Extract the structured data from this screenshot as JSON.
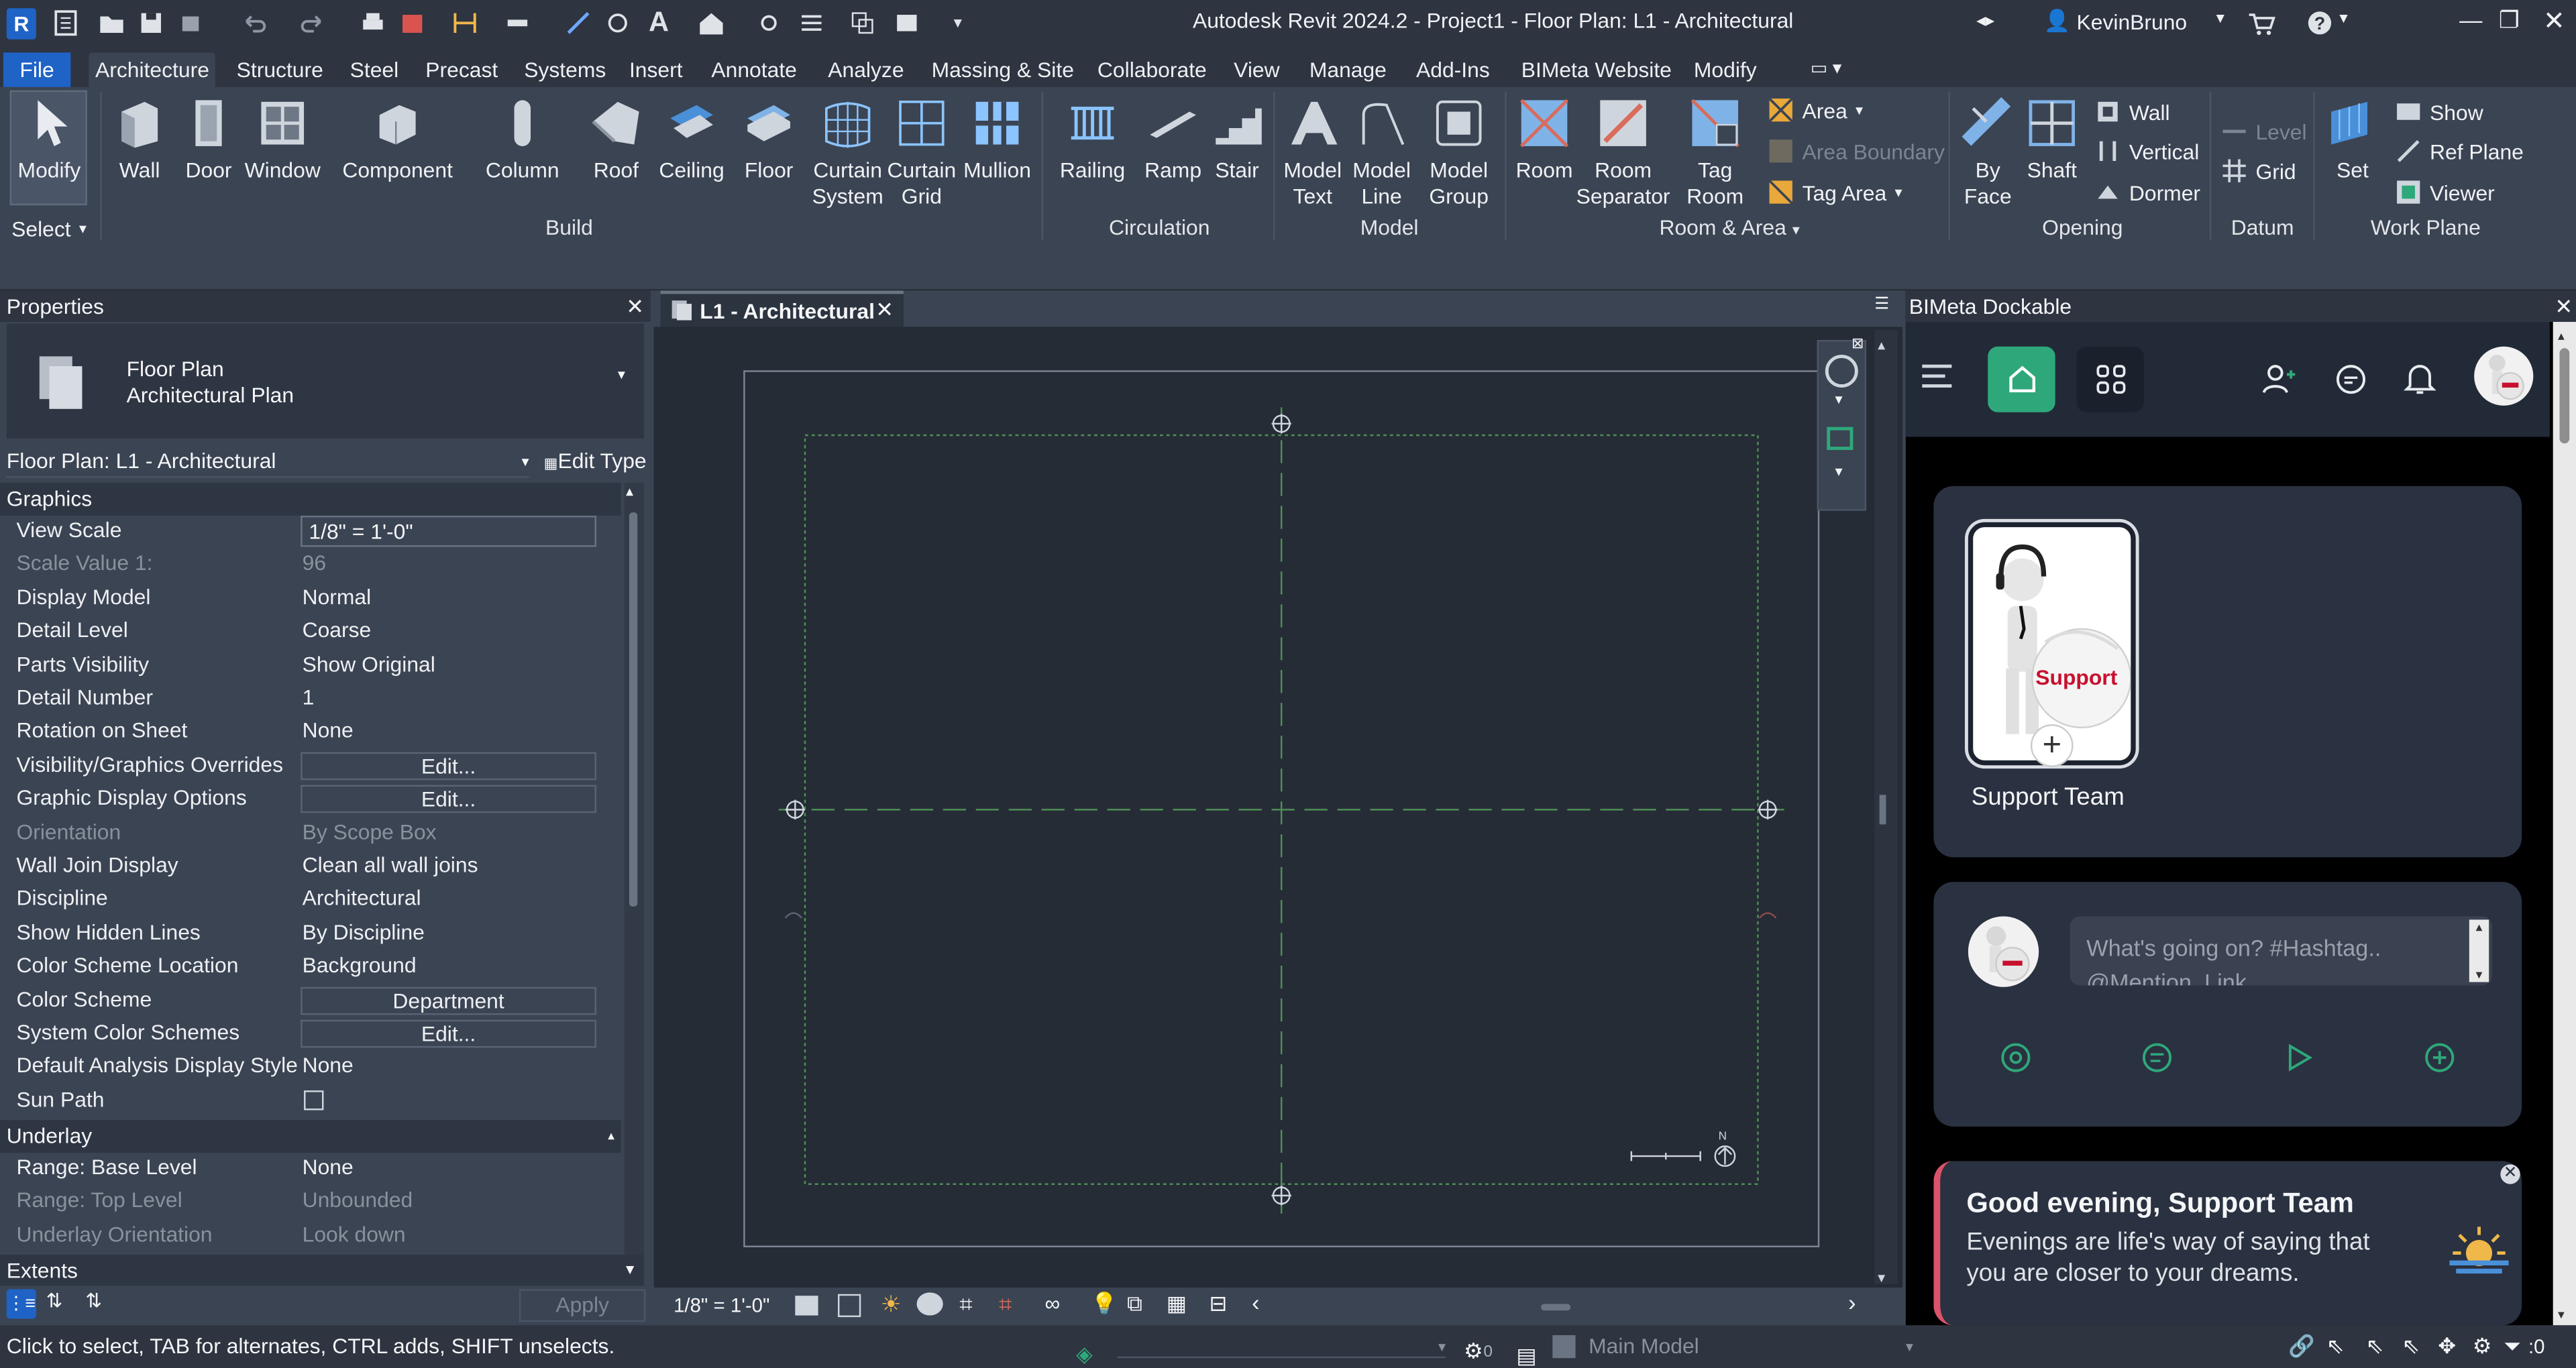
{
  "titlebar": {
    "title": "Autodesk Revit 2024.2 - Project1 - Floor Plan: L1 - Architectural",
    "user": "KevinBruno",
    "app_icon": "R"
  },
  "tabs": [
    "File",
    "Architecture",
    "Structure",
    "Steel",
    "Precast",
    "Systems",
    "Insert",
    "Annotate",
    "Analyze",
    "Massing & Site",
    "Collaborate",
    "View",
    "Manage",
    "Add-Ins",
    "BIMeta Website",
    "Modify"
  ],
  "ribbon": {
    "modify": "Modify",
    "select": "Select",
    "build": [
      "Wall",
      "Door",
      "Window",
      "Component",
      "Column",
      "Roof",
      "Ceiling",
      "Floor"
    ],
    "curtain_system": [
      "Curtain",
      "System"
    ],
    "curtain_grid": [
      "Curtain",
      "Grid"
    ],
    "mullion": "Mullion",
    "build_panel": "Build",
    "circulation": [
      "Railing",
      "Ramp",
      "Stair"
    ],
    "circulation_panel": "Circulation",
    "model_text": [
      "Model",
      "Text"
    ],
    "model_line": [
      "Model",
      "Line"
    ],
    "model_group": [
      "Model",
      "Group"
    ],
    "model_panel": "Model",
    "room": "Room",
    "room_separator": [
      "Room",
      "Separator"
    ],
    "tag_room": [
      "Tag",
      "Room"
    ],
    "area": "Area",
    "area_boundary": "Area  Boundary",
    "tag_area": "Tag  Area",
    "room_area_panel": "Room & Area",
    "by_face": [
      "By",
      "Face"
    ],
    "shaft": "Shaft",
    "wall": "Wall",
    "vertical": "Vertical",
    "dormer": "Dormer",
    "opening_panel": "Opening",
    "level": "Level",
    "grid": "Grid",
    "datum_panel": "Datum",
    "set": "Set",
    "show": "Show",
    "ref_plane": "Ref  Plane",
    "viewer": "Viewer",
    "work_plane_panel": "Work Plane"
  },
  "properties": {
    "title": "Properties",
    "type_line1": "Floor Plan",
    "type_line2": "Architectural Plan",
    "selector": "Floor Plan: L1 - Architectural",
    "edit_type": "Edit Type",
    "group_graphics": "Graphics",
    "rows": [
      {
        "k": "View Scale",
        "v": "1/8\" = 1'-0\""
      },
      {
        "k": "Scale Value    1:",
        "v": "96"
      },
      {
        "k": "Display Model",
        "v": "Normal"
      },
      {
        "k": "Detail Level",
        "v": "Coarse"
      },
      {
        "k": "Parts Visibility",
        "v": "Show Original"
      },
      {
        "k": "Detail Number",
        "v": "1"
      },
      {
        "k": "Rotation on Sheet",
        "v": "None"
      },
      {
        "k": "Visibility/Graphics Overrides",
        "v": "Edit..."
      },
      {
        "k": "Graphic Display Options",
        "v": "Edit..."
      },
      {
        "k": "Orientation",
        "v": "By Scope Box"
      },
      {
        "k": "Wall Join Display",
        "v": "Clean all wall joins"
      },
      {
        "k": "Discipline",
        "v": "Architectural"
      },
      {
        "k": "Show Hidden Lines",
        "v": "By Discipline"
      },
      {
        "k": "Color Scheme Location",
        "v": "Background"
      },
      {
        "k": "Color Scheme",
        "v": "Department"
      },
      {
        "k": "System Color Schemes",
        "v": "Edit..."
      },
      {
        "k": "Default Analysis Display Style",
        "v": "None"
      },
      {
        "k": "Sun Path",
        "v": ""
      }
    ],
    "group_underlay": "Underlay",
    "underlay_rows": [
      {
        "k": "Range: Base Level",
        "v": "None"
      },
      {
        "k": "Range: Top Level",
        "v": "Unbounded"
      },
      {
        "k": "Underlay Orientation",
        "v": "Look down"
      }
    ],
    "group_extents": "Extents",
    "apply": "Apply"
  },
  "view": {
    "tab": "L1 - Architectural",
    "scale": "1/8\" = 1'-0\"",
    "north": "N"
  },
  "dock": {
    "title": "BIMeta Dockable",
    "support_card_label": "Support Team",
    "support_badge": "Support",
    "post_placeholder": "What's going on? #Hashtag..",
    "post_placeholder2": "@Mention..Link",
    "greeting_title": "Good evening, Support Team",
    "greeting_text": "Evenings are life's way of saying that you are closer to your dreams."
  },
  "status": {
    "hint": "Click to select, TAB for alternates, CTRL adds, SHIFT unselects.",
    "model": "Main Model",
    "filter_count": ":0",
    "count": "0"
  },
  "colors": {
    "accent_green": "#2ea87a",
    "file_blue": "#1f63c6",
    "panel": "#3b4453",
    "canvas": "#252c36"
  }
}
